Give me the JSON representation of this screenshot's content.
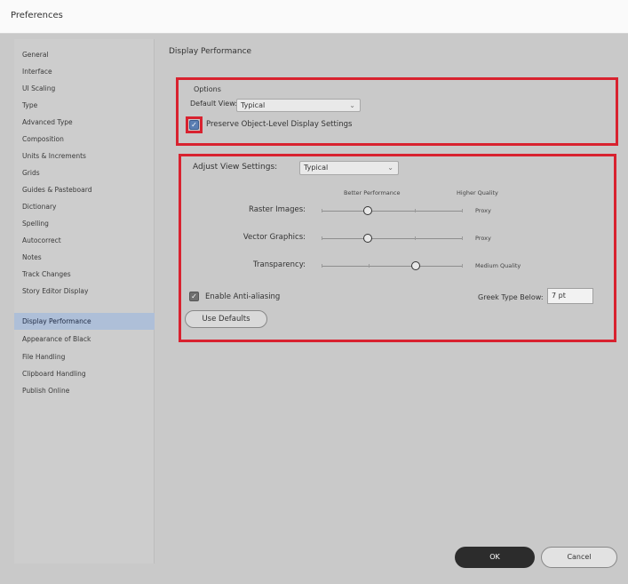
{
  "window": {
    "title": "Preferences"
  },
  "sidebar": {
    "items": [
      {
        "label": "General"
      },
      {
        "label": "Interface"
      },
      {
        "label": "UI Scaling"
      },
      {
        "label": "Type"
      },
      {
        "label": "Advanced Type"
      },
      {
        "label": "Composition"
      },
      {
        "label": "Units & Increments"
      },
      {
        "label": "Grids"
      },
      {
        "label": "Guides & Pasteboard"
      },
      {
        "label": "Dictionary"
      },
      {
        "label": "Spelling"
      },
      {
        "label": "Autocorrect"
      },
      {
        "label": "Notes"
      },
      {
        "label": "Track Changes"
      },
      {
        "label": "Story Editor Display"
      },
      {
        "label": "Display Performance"
      },
      {
        "label": "Appearance of Black"
      },
      {
        "label": "File Handling"
      },
      {
        "label": "Clipboard Handling"
      },
      {
        "label": "Publish Online"
      }
    ],
    "selected": "Display Performance"
  },
  "main": {
    "panel_title": "Display Performance",
    "options": {
      "title": "Options",
      "default_view_label": "Default View:",
      "default_view_value": "Typical",
      "preserve_label": "Preserve Object-Level Display Settings",
      "preserve_checked": true
    },
    "adjust": {
      "label": "Adjust View Settings:",
      "value": "Typical",
      "better_performance": "Better Performance",
      "higher_quality": "Higher Quality",
      "sliders": [
        {
          "label": "Raster Images:",
          "value_text": "Proxy",
          "level": 0.33
        },
        {
          "label": "Vector Graphics:",
          "value_text": "Proxy",
          "level": 0.33
        },
        {
          "label": "Transparency:",
          "value_text": "Medium Quality",
          "level": 0.67
        }
      ],
      "anti_alias_label": "Enable Anti-aliasing",
      "anti_alias_checked": true,
      "greek_label": "Greek Type Below:",
      "greek_value": "7 pt",
      "use_defaults_label": "Use Defaults"
    }
  },
  "footer": {
    "ok_label": "OK",
    "cancel_label": "Cancel"
  },
  "colors": {
    "highlight_red": "#d8222f",
    "selection": "#aebfd8",
    "ok_button": "#2c2c2c"
  }
}
